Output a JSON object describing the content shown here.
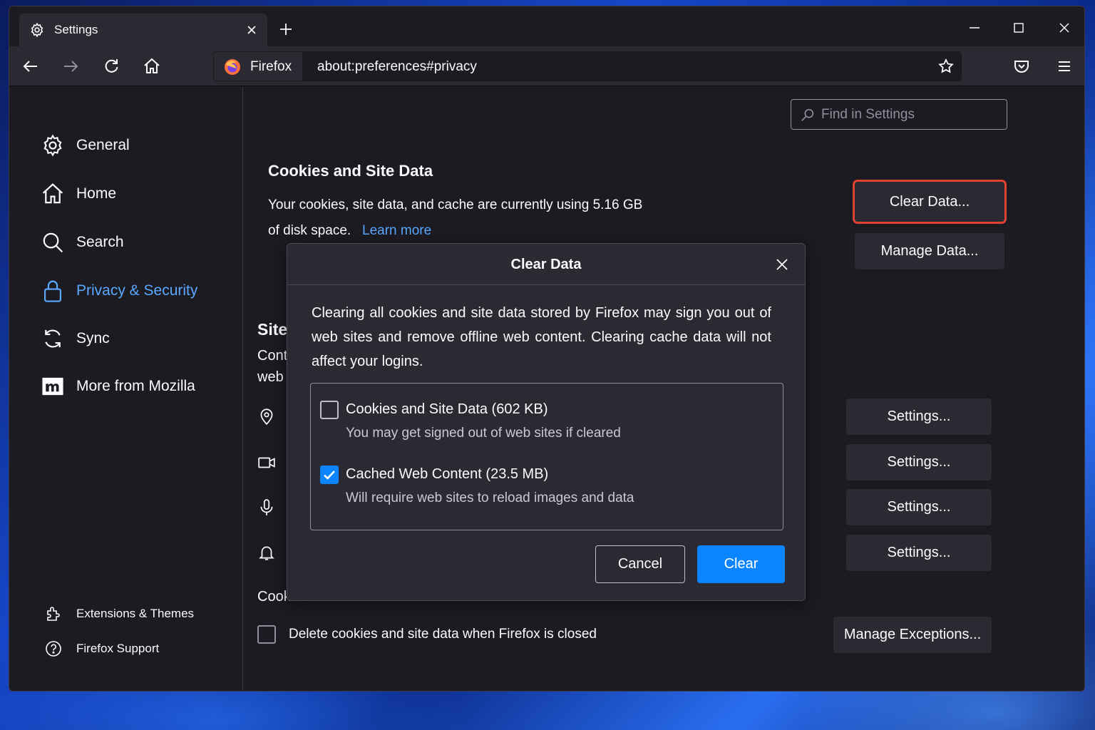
{
  "tab": {
    "title": "Settings"
  },
  "identity": {
    "label": "Firefox"
  },
  "url": "about:preferences#privacy",
  "search": {
    "placeholder": "Find in Settings"
  },
  "sidebar": {
    "items": [
      {
        "label": "General",
        "icon": "gear-icon"
      },
      {
        "label": "Home",
        "icon": "home-icon"
      },
      {
        "label": "Search",
        "icon": "search-icon"
      },
      {
        "label": "Privacy & Security",
        "icon": "lock-icon",
        "selected": true
      },
      {
        "label": "Sync",
        "icon": "sync-icon"
      },
      {
        "label": "More from Mozilla",
        "icon": "mozilla-icon"
      }
    ],
    "footer": [
      {
        "label": "Extensions & Themes",
        "icon": "extensions-icon"
      },
      {
        "label": "Firefox Support",
        "icon": "help-icon"
      }
    ]
  },
  "cookies": {
    "heading": "Cookies and Site Data",
    "text1": "Your cookies, site data, and cache are currently using 5.16 GB",
    "text2": "of disk space.",
    "learn_more": "Learn more",
    "clear_data_button": "Clear Data...",
    "manage_data_button": "Manage Data...",
    "delete_on_close_label": "Delete cookies and site data when Firefox is closed",
    "delete_on_close_checked": false,
    "manage_exceptions_button": "Manage Exceptions..."
  },
  "partial": {
    "site_heading": "Site",
    "cont": "Cont",
    "web": "web",
    "cook": "Cook"
  },
  "permissions": {
    "settings_buttons": [
      "Settings...",
      "Settings...",
      "Settings...",
      "Settings..."
    ]
  },
  "dialog": {
    "title": "Clear Data",
    "description": "Clearing all cookies and site data stored by Firefox may sign you out of web sites and remove offline web content. Clearing cache data will not affect your logins.",
    "options": [
      {
        "label": "Cookies and Site Data (602 KB)",
        "description": "You may get signed out of web sites if cleared",
        "checked": false
      },
      {
        "label": "Cached Web Content (23.5 MB)",
        "description": "Will require web sites to reload images and data",
        "checked": true
      }
    ],
    "cancel_label": "Cancel",
    "clear_label": "Clear"
  },
  "colors": {
    "accent": "#0a84ff",
    "link": "#5aa8ff",
    "highlight_outline": "#e0432f",
    "background": "#1c1b22",
    "surface": "#2b2a33"
  }
}
